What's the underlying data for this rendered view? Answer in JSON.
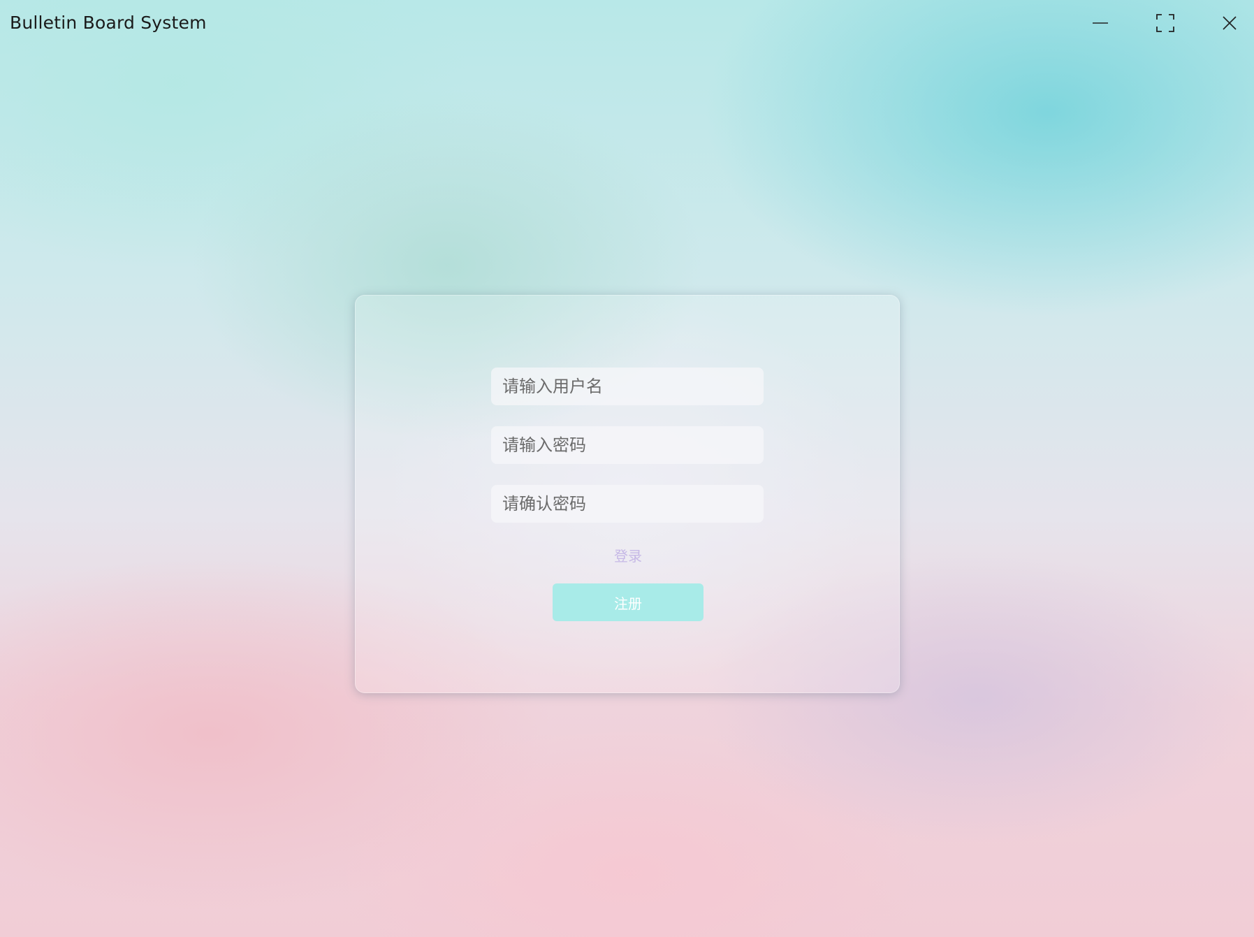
{
  "window": {
    "title": "Bulletin Board System",
    "controls": {
      "minimize": "minimize-icon",
      "maximize": "maximize-icon",
      "close": "close-icon"
    }
  },
  "register_form": {
    "username_placeholder": "请输入用户名",
    "password_placeholder": "请输入密码",
    "confirm_password_placeholder": "请确认密码",
    "login_link": "登录",
    "register_button": "注册"
  },
  "colors": {
    "register_button_bg": "#a8ebe8",
    "login_link": "#c6b8e6"
  }
}
